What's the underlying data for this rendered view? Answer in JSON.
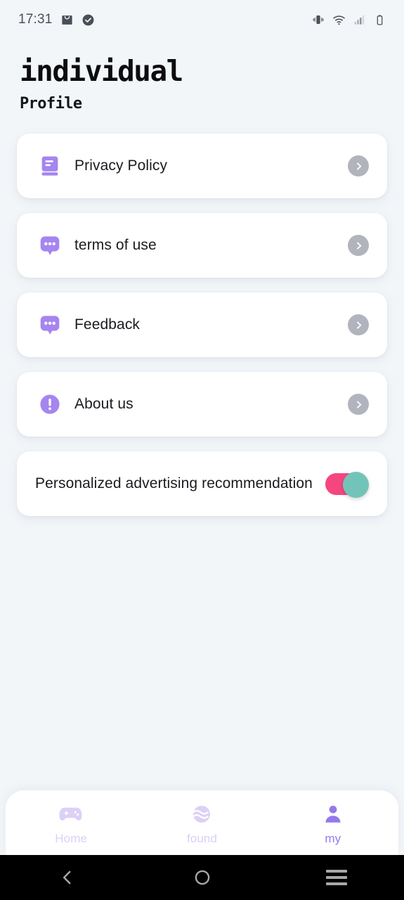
{
  "status_bar": {
    "time": "17:31",
    "left_icons": [
      "mail-icon",
      "check-circle-icon"
    ],
    "right_icons": [
      "vibrate-icon",
      "wifi-icon",
      "signal-bars-icon",
      "battery-icon"
    ]
  },
  "header": {
    "title": "individual",
    "subtitle": "Profile"
  },
  "menu": {
    "items": [
      {
        "label": "Privacy Policy",
        "icon": "book-icon",
        "action": "chevron-right-icon"
      },
      {
        "label": "terms of use",
        "icon": "speech-bubble-icon",
        "action": "chevron-right-icon"
      },
      {
        "label": "Feedback",
        "icon": "speech-bubble-icon",
        "action": "chevron-right-icon"
      },
      {
        "label": "About us",
        "icon": "info-circle-icon",
        "action": "chevron-right-icon"
      }
    ],
    "toggle_row": {
      "label": "Personalized advertising recommendation",
      "toggle_state": "on",
      "track_color": "#f6467f",
      "knob_color": "#73c4b8"
    }
  },
  "bottom_nav": {
    "items": [
      {
        "label": "Home",
        "icon": "gamepad-icon",
        "active": false
      },
      {
        "label": "found",
        "icon": "globe-icon",
        "active": false
      },
      {
        "label": "my",
        "icon": "person-icon",
        "active": true
      }
    ],
    "active_color": "#9579ea",
    "inactive_color": "#ddd0f6"
  },
  "android_nav": {
    "buttons": [
      "back-icon",
      "home-circle-icon",
      "recents-icon"
    ]
  },
  "theme": {
    "background": "#f2f6f9",
    "card_background": "#ffffff",
    "accent_purple": "#a585f0",
    "chevron_grey": "#b2b4bd"
  }
}
